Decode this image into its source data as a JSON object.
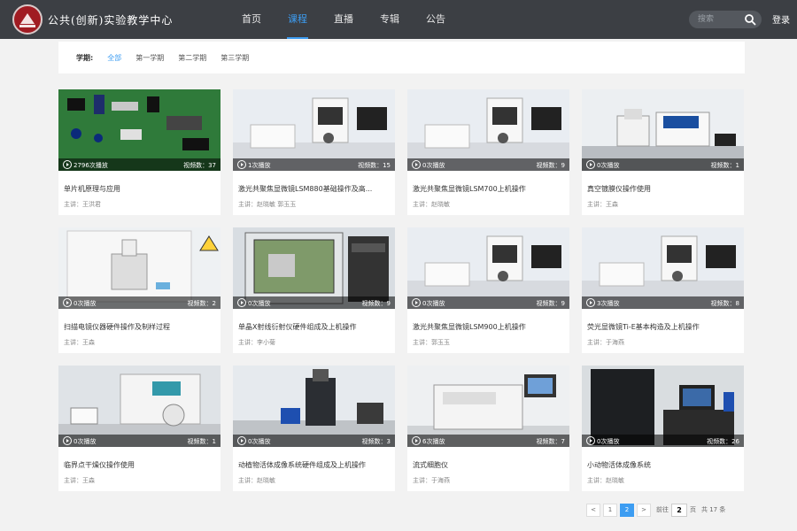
{
  "header": {
    "site_title": "公共(创新)实验教学中心",
    "nav": [
      "首页",
      "课程",
      "直播",
      "专辑",
      "公告"
    ],
    "active_nav": 1,
    "search_placeholder": "搜索",
    "login_label": "登录"
  },
  "filter": {
    "label": "学期:",
    "options": [
      "全部",
      "第一学期",
      "第二学期",
      "第三学期"
    ],
    "active": 0
  },
  "courses": [
    {
      "title": "单片机原理与应用",
      "teacher": "主讲：王洪君",
      "views": "2796次播放",
      "videos": "视频数：37",
      "thumb": "pcb"
    },
    {
      "title": "激光共聚焦显微镜LSM880基础操作及高...",
      "teacher": "主讲：赵晓敏  郭玉玉",
      "views": "1次播放",
      "videos": "视频数：15",
      "thumb": "lab"
    },
    {
      "title": "激光共聚焦显微镜LSM700上机操作",
      "teacher": "主讲：赵晓敏",
      "views": "0次播放",
      "videos": "视频数：9",
      "thumb": "lab"
    },
    {
      "title": "真空镀膜仪操作使用",
      "teacher": "主讲：王森",
      "views": "0次播放",
      "videos": "视频数：1",
      "thumb": "bench"
    },
    {
      "title": "扫描电镜仪器硬件操作及制样过程",
      "teacher": "主讲：王森",
      "views": "0次播放",
      "videos": "视频数：2",
      "thumb": "hood"
    },
    {
      "title": "单晶X射线衍射仪硬件组成及上机操作",
      "teacher": "主讲：李小菊",
      "views": "0次播放",
      "videos": "视频数：9",
      "thumb": "xray"
    },
    {
      "title": "激光共聚焦显微镜LSM900上机操作",
      "teacher": "主讲：郭玉玉",
      "views": "0次播放",
      "videos": "视频数：9",
      "thumb": "lab"
    },
    {
      "title": "荧光显微镜Ti-E基本构造及上机操作",
      "teacher": "主讲：于海燕",
      "views": "3次播放",
      "videos": "视频数：8",
      "thumb": "lab"
    },
    {
      "title": "临界点干燥仪操作使用",
      "teacher": "主讲：王森",
      "views": "0次播放",
      "videos": "视频数：1",
      "thumb": "dryer"
    },
    {
      "title": "动植物活体成像系统硬件组成及上机操作",
      "teacher": "主讲：赵晓敏",
      "views": "0次播放",
      "videos": "视频数：3",
      "thumb": "imaging"
    },
    {
      "title": "流式细胞仪",
      "teacher": "主讲：于海燕",
      "views": "6次播放",
      "videos": "视频数：7",
      "thumb": "cyto"
    },
    {
      "title": "小动物活体成像系统",
      "teacher": "主讲：赵晓敏",
      "views": "0次播放",
      "videos": "视频数：26",
      "thumb": "cabinet"
    }
  ],
  "pagination": {
    "prev": "<",
    "pages": [
      "1",
      "2"
    ],
    "current": 2,
    "next": ">",
    "goto_label": "前往",
    "goto_value": "2",
    "page_unit": "页",
    "total": "共 17 条"
  },
  "colors": {
    "accent": "#3d9df2",
    "header_bg": "#3c3f44",
    "page_bg": "#f2f2f2"
  }
}
